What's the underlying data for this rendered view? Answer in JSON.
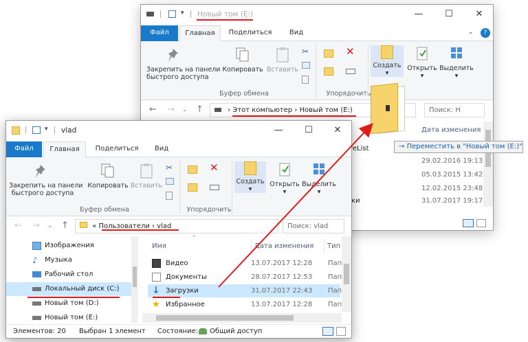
{
  "colors": {
    "accent": "#1979ca",
    "selection": "#cce8ff",
    "annotation_red": "#e01b1b",
    "folder_yellow": "#f7d46b"
  },
  "back_window": {
    "title": "Новый том (E:)",
    "controls": {
      "minimize": "—",
      "maximize": "☐",
      "close": "✕"
    },
    "tabs": [
      "Файл",
      "Главная",
      "Поделиться",
      "Вид"
    ],
    "ribbon": {
      "pin_label": "Закрепить на панели быстрого доступа",
      "pin_line1": "Закрепить на панели",
      "pin_line2": "быстрого доступа",
      "copy_label": "Копировать",
      "paste_label": "Вставить",
      "clipboard_group": "Буфер обмена",
      "organize_group": "Упорядочить",
      "create_label": "Создать",
      "open_label": "Открыть",
      "select_label": "Выделить"
    },
    "address": {
      "part1": "Этот компьютер",
      "sep": "›",
      "part2": "Новый том (E:)",
      "search_placeholder": "Поиск: Н"
    },
    "list": {
      "date_header": "Дата изменения",
      "partial_name_1": "reList",
      "partial_name_2": "ки",
      "dates": [
        "29.02.2016 19:13",
        "05.03.2015 13:42",
        "12.02.2015 23:48",
        "31.07.2017 19:17"
      ]
    }
  },
  "tooltip": {
    "arrow": "→",
    "text": "Переместить в \"Новый том (E:)\""
  },
  "front_window": {
    "title": "vlad",
    "controls": {
      "minimize": "—",
      "maximize": "☐",
      "close": "✕"
    },
    "tabs": [
      "Файл",
      "Главная",
      "Поделиться",
      "Вид"
    ],
    "ribbon": {
      "pin_line1": "Закрепить на панели",
      "pin_line2": "быстрого доступа",
      "copy_label": "Копировать",
      "paste_label": "Вставить",
      "clipboard_group": "Буфер обмена",
      "organize_group": "Упорядочить",
      "create_label": "Создать",
      "open_label": "Открыть",
      "select_label": "Выделить"
    },
    "address": {
      "prefix": "«",
      "part1": "Пользователи",
      "sep": "›",
      "part2": "vlad",
      "search_placeholder": "Поиск: vlad"
    },
    "nav": [
      {
        "label": "Изображения",
        "icon": "pictures-icon"
      },
      {
        "label": "Музыка",
        "icon": "music-icon"
      },
      {
        "label": "Рабочий стол",
        "icon": "desktop-icon"
      },
      {
        "label": "Локальный диск (C:)",
        "icon": "drive-icon",
        "selected": true
      },
      {
        "label": "Новый том (D:)",
        "icon": "drive-icon"
      },
      {
        "label": "Новый том (E:)",
        "icon": "drive-icon"
      }
    ],
    "columns": {
      "name": "Имя",
      "date": "Дата изменения",
      "type": "Тип"
    },
    "files": [
      {
        "name": "Видео",
        "date": "13.07.2017 12:28",
        "type": "Пап",
        "icon": "video-folder-icon"
      },
      {
        "name": "Документы",
        "date": "28.07.2017 12:53",
        "type": "Пап",
        "icon": "documents-folder-icon"
      },
      {
        "name": "Загрузки",
        "date": "31.07.2017 22:43",
        "type": "Пап",
        "icon": "downloads-folder-icon",
        "selected": true
      },
      {
        "name": "Избранное",
        "date": "13.07.2017 12:28",
        "type": "Пап",
        "icon": "favorites-folder-icon"
      }
    ],
    "status": {
      "items": "Элементов: 20",
      "selected": "Выбран 1 элемент",
      "state_label": "Состояние:",
      "state_value": "Общий доступ"
    }
  }
}
